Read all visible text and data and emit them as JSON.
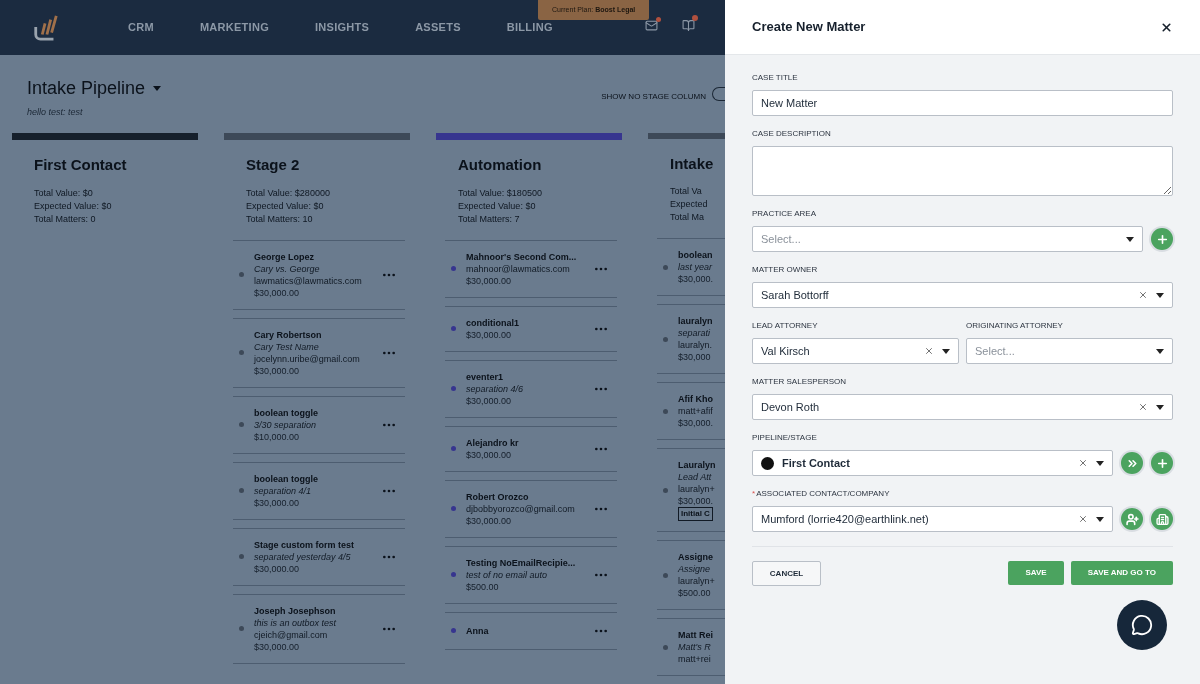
{
  "nav": {
    "items": [
      "CRM",
      "MARKETING",
      "INSIGHTS",
      "ASSETS",
      "BILLING"
    ],
    "plan_banner": "Current Plan: **Boost Legal**",
    "mail_badge": true,
    "book_badge": true
  },
  "pipeline": {
    "title": "Intake Pipeline",
    "subtitle": "hello test: test",
    "toggle_label": "SHOW NO STAGE COLUMN",
    "show_no_stage": false
  },
  "columns": [
    {
      "name": "First Contact",
      "color": "#16202c",
      "stats": [
        "Total Value: $0",
        "Expected Value: $0",
        "Total Matters: 0"
      ]
    },
    {
      "name": "Stage 2",
      "color": "#3d4958",
      "stats": [
        "Total Value: $280000",
        "Expected Value: $0",
        "Total Matters: 10"
      ],
      "cards": [
        {
          "title": "George Lopez",
          "note": "Cary vs. George",
          "email": "lawmatics@lawmatics.com",
          "amount": "$30,000.00"
        },
        {
          "title": "Cary Robertson",
          "note": "Cary Test Name",
          "email": "jocelynn.uribe@gmail.com",
          "amount": "$30,000.00"
        },
        {
          "title": "boolean toggle",
          "note": "3/30 separation",
          "amount": "$10,000.00"
        },
        {
          "title": "boolean toggle",
          "note": "separation 4/1",
          "amount": "$30,000.00"
        },
        {
          "title": "Stage custom form test",
          "note": "separated yesterday 4/5",
          "amount": "$30,000.00"
        },
        {
          "title": "Joseph Josephson",
          "note": "this is an outbox test",
          "email": "cjeich@gmail.com",
          "amount": "$30,000.00"
        }
      ]
    },
    {
      "name": "Automation",
      "color": "#37358f",
      "stats": [
        "Total Value: $180500",
        "Expected Value: $0",
        "Total Matters: 7"
      ],
      "cards": [
        {
          "title": "Mahnoor's Second Com...",
          "email": "mahnoor@lawmatics.com",
          "amount": "$30,000.00"
        },
        {
          "title": "conditional1",
          "amount": "$30,000.00"
        },
        {
          "title": "eventer1",
          "note": "separation 4/6",
          "amount": "$30,000.00"
        },
        {
          "title": "Alejandro kr",
          "amount": "$30,000.00"
        },
        {
          "title": "Robert Orozco",
          "email": "djbobbyorozco@gmail.com",
          "amount": "$30,000.00"
        },
        {
          "title": "Testing NoEmailRecipie...",
          "note": "test of no email auto",
          "amount": "$500.00"
        },
        {
          "title": "Anna"
        }
      ]
    },
    {
      "name": "Intake",
      "color": "#3d4958",
      "stats": [
        "Total Va",
        "Expected",
        "Total Ma"
      ],
      "cards": [
        {
          "title": "boolean",
          "note": "last year",
          "amount": "$30,000.",
          "menu": false
        },
        {
          "title": "lauralyn",
          "note": "separati",
          "email": "lauralyn.",
          "amount": "$30,000",
          "menu": false
        },
        {
          "title": "Afif Kho",
          "email": "matt+afif",
          "amount": "$30,000.",
          "menu": false
        },
        {
          "title": "Lauralyn",
          "note": "Lead Att",
          "email": "lauralyn+",
          "amount": "$30,000.",
          "tag": "Initial C",
          "menu": false
        },
        {
          "title": "Assigne",
          "note": "Assigne",
          "email": "lauralyn+",
          "amount": "$500.00",
          "menu": false
        },
        {
          "title": "Matt Rei",
          "note": "Matt's R",
          "email": "matt+rei",
          "menu": false
        }
      ]
    }
  ],
  "modal": {
    "title": "Create New Matter",
    "rows": [
      [
        {
          "label": "CASE TITLE",
          "kind": "text",
          "value": "New Matter"
        }
      ],
      [
        {
          "label": "CASE DESCRIPTION",
          "kind": "textarea"
        }
      ],
      [
        {
          "label": "PRACTICE AREA",
          "kind": "select",
          "placeholder": "Select...",
          "clearable": false,
          "actions": [
            {
              "kind": "add"
            }
          ]
        }
      ],
      [
        {
          "label": "MATTER OWNER",
          "kind": "select",
          "value": "Sarah Bottorff",
          "clearable": true
        }
      ],
      [
        {
          "label": "LEAD ATTORNEY",
          "kind": "select",
          "value": "Val Kirsch",
          "clearable": true
        },
        {
          "label": "ORIGINATING ATTORNEY",
          "kind": "select",
          "placeholder": "Select...",
          "clearable": false
        }
      ],
      [
        {
          "label": "MATTER SALESPERSON",
          "kind": "select",
          "value": "Devon Roth",
          "clearable": true
        }
      ],
      [
        {
          "label": "PIPELINE/STAGE",
          "kind": "select",
          "value": "First Contact",
          "color": "#111111",
          "clearable": true,
          "actions": [
            {
              "kind": "advance"
            },
            {
              "kind": "add"
            }
          ]
        }
      ],
      [
        {
          "label": "ASSOCIATED CONTACT/COMPANY",
          "required_mark": "*",
          "kind": "select",
          "value": "Mumford (lorrie420@earthlink.net)",
          "clearable": true,
          "actions": [
            {
              "kind": "add-person"
            },
            {
              "kind": "add-company"
            }
          ]
        }
      ]
    ],
    "buttons": [
      {
        "label": "CANCEL",
        "kind": "secondary"
      },
      {
        "label": "SAVE",
        "kind": "primary"
      },
      {
        "label": "SAVE AND GO TO",
        "kind": "primary"
      }
    ]
  }
}
